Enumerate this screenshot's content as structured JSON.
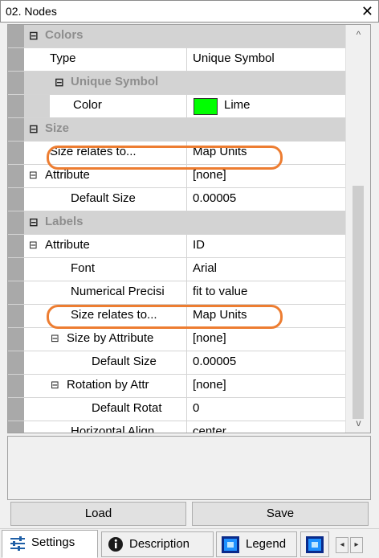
{
  "window": {
    "title": "02. Nodes",
    "close_glyph": "✕"
  },
  "grid": {
    "rows": [
      {
        "kind": "cat",
        "pm": "⊟",
        "label": "Colors"
      },
      {
        "kind": "prop",
        "name": "Type",
        "value": "Unique Symbol"
      },
      {
        "kind": "cat",
        "pm": "⊟",
        "label": "Unique Symbol"
      },
      {
        "kind": "prop",
        "name": "Color",
        "value": "Lime"
      },
      {
        "kind": "cat",
        "pm": "⊟",
        "label": "Size"
      },
      {
        "kind": "prop",
        "name": "Size relates to...",
        "value": "Map Units"
      },
      {
        "kind": "prop",
        "pm": "⊟",
        "name": "Attribute",
        "value": "[none]"
      },
      {
        "kind": "prop",
        "name": "Default Size",
        "value": "0.00005"
      },
      {
        "kind": "cat",
        "pm": "⊟",
        "label": "Labels"
      },
      {
        "kind": "prop",
        "pm": "⊟",
        "name": "Attribute",
        "value": "ID"
      },
      {
        "kind": "prop",
        "name": "Font",
        "value": "Arial"
      },
      {
        "kind": "prop",
        "name": "Numerical Precisi",
        "value": "fit to value"
      },
      {
        "kind": "prop",
        "name": "Size relates to...",
        "value": "Map Units"
      },
      {
        "kind": "prop",
        "pm": "⊟",
        "name": "Size by Attribute",
        "value": "[none]"
      },
      {
        "kind": "prop",
        "name": "Default Size",
        "value": "0.00005"
      },
      {
        "kind": "prop",
        "pm": "⊟",
        "name": "Rotation by Attr",
        "value": "[none]"
      },
      {
        "kind": "prop",
        "name": "Default Rotat",
        "value": "0"
      },
      {
        "kind": "prop",
        "name": "Horizontal Align",
        "value": "center"
      }
    ],
    "swatch_color": "#00ff00",
    "highlight_color": "#ed7d31",
    "scroll_up_glyph": "^",
    "scroll_down_glyph": "v"
  },
  "buttons": {
    "load": "Load",
    "save": "Save"
  },
  "tabs": [
    {
      "label": "Settings",
      "icon": "sliders-icon",
      "active": true
    },
    {
      "label": "Description",
      "icon": "info-icon",
      "active": false
    },
    {
      "label": "Legend",
      "icon": "legend-icon",
      "active": false
    }
  ],
  "tab_nav": {
    "left_glyph": "◂",
    "right_glyph": "▸"
  }
}
